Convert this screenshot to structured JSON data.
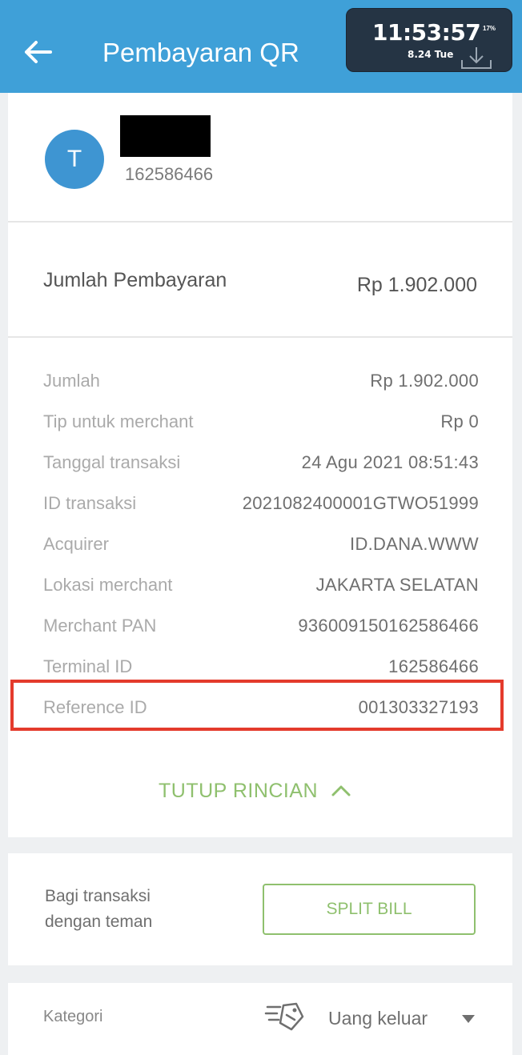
{
  "appbar": {
    "title": "Pembayaran QR",
    "back_icon": "arrow-left-icon",
    "background": "#3fa0d8"
  },
  "clock": {
    "time": "11:53:57",
    "date": "8.24 Tue",
    "battery": "17%"
  },
  "merchant": {
    "avatar_initial": "T",
    "number": "162586466"
  },
  "payment": {
    "label": "Jumlah Pembayaran",
    "amount": "Rp 1.902.000"
  },
  "details": [
    {
      "label": "Jumlah",
      "value": "Rp 1.902.000"
    },
    {
      "label": "Tip untuk merchant",
      "value": "Rp 0"
    },
    {
      "label": "Tanggal transaksi",
      "value": "24 Agu 2021 08:51:43"
    },
    {
      "label": "ID transaksi",
      "value": "2021082400001GTWO51999"
    },
    {
      "label": "Acquirer",
      "value": "ID.DANA.WWW"
    },
    {
      "label": "Lokasi merchant",
      "value": "JAKARTA SELATAN"
    },
    {
      "label": "Merchant PAN",
      "value": "936009150162586466"
    },
    {
      "label": "Terminal ID",
      "value": "162586466"
    },
    {
      "label": "Reference ID",
      "value": "001303327193"
    }
  ],
  "toggle": {
    "label": "TUTUP RINCIAN",
    "icon": "chevron-up-icon"
  },
  "split": {
    "text": "Bagi transaksi dengan teman",
    "button": "SPLIT BILL"
  },
  "category": {
    "label": "Kategori",
    "value": "Uang keluar",
    "icon": "tag-icon",
    "dropdown_icon": "caret-down-icon"
  },
  "colors": {
    "accent_green": "#8fc06e",
    "highlight_red": "#e43b2c",
    "avatar_blue": "#3e95d2"
  }
}
